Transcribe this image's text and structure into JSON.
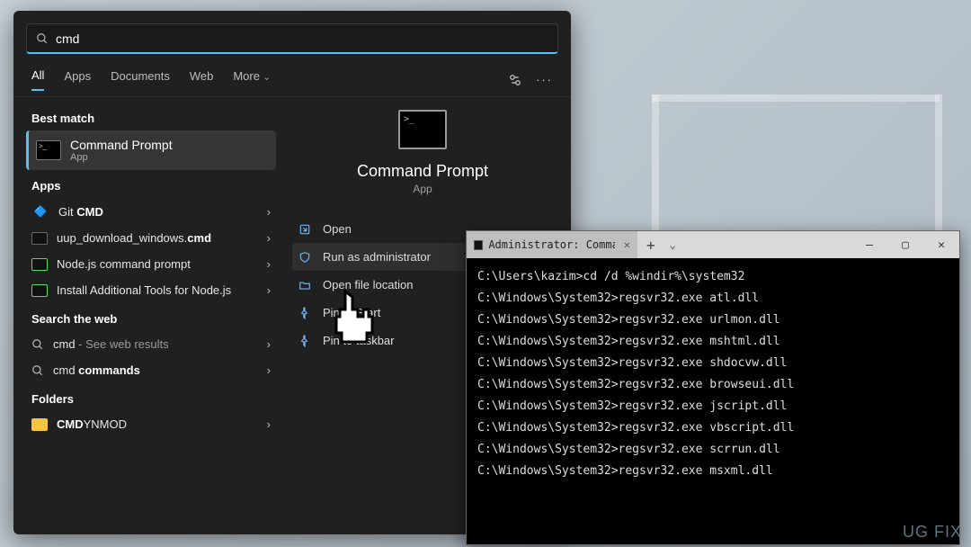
{
  "search": {
    "query": "cmd"
  },
  "tabs": [
    "All",
    "Apps",
    "Documents",
    "Web",
    "More"
  ],
  "sections": {
    "best_match_h": "Best match",
    "apps_h": "Apps",
    "web_h": "Search the web",
    "folders_h": "Folders"
  },
  "best_match": {
    "title": "Command Prompt",
    "subtitle": "App"
  },
  "apps": [
    {
      "label_prefix": "Git ",
      "label_bold": "CMD"
    },
    {
      "label_prefix": "uup_download_windows.",
      "label_bold": "cmd"
    },
    {
      "label_prefix": "Node.js ",
      "label_bold": "command prompt",
      "bold_mode": "plain"
    },
    {
      "label_prefix": "Install Additional Tools for Node.js",
      "label_bold": ""
    }
  ],
  "web": [
    {
      "q": "cmd",
      "suffix": " - See web results"
    },
    {
      "q": "cmd ",
      "bold": "commands"
    }
  ],
  "folders": [
    {
      "prefix": "",
      "bold": "CMD",
      "suffix": "YNMOD"
    }
  ],
  "preview": {
    "title": "Command Prompt",
    "subtitle": "App",
    "actions": [
      {
        "icon": "open",
        "label": "Open"
      },
      {
        "icon": "shield",
        "label": "Run as administrator"
      },
      {
        "icon": "folder",
        "label": "Open file location"
      },
      {
        "icon": "pin",
        "label": "Pin to Start"
      },
      {
        "icon": "pin",
        "label": "Pin to taskbar"
      }
    ]
  },
  "terminal": {
    "tab_title": "Administrator: Command Promp",
    "lines": [
      "C:\\Users\\kazim>cd /d %windir%\\system32",
      "",
      "C:\\Windows\\System32>regsvr32.exe atl.dll",
      "",
      "C:\\Windows\\System32>regsvr32.exe urlmon.dll",
      "",
      "C:\\Windows\\System32>regsvr32.exe mshtml.dll",
      "",
      "C:\\Windows\\System32>regsvr32.exe shdocvw.dll",
      "",
      "C:\\Windows\\System32>regsvr32.exe browseui.dll",
      "",
      "C:\\Windows\\System32>regsvr32.exe jscript.dll",
      "",
      "C:\\Windows\\System32>regsvr32.exe vbscript.dll",
      "",
      "C:\\Windows\\System32>regsvr32.exe scrrun.dll",
      "",
      "C:\\Windows\\System32>regsvr32.exe msxml.dll"
    ]
  },
  "watermark": "UG   FIX"
}
